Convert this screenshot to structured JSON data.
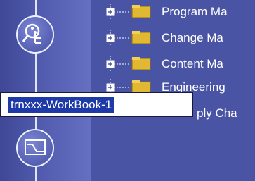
{
  "tree": {
    "items": [
      {
        "label": "Program Ma",
        "icon": "folder-icon"
      },
      {
        "label": "Change Ma",
        "icon": "folder-icon"
      },
      {
        "label": "Content Ma",
        "icon": "folder-icon"
      },
      {
        "label": "Engineering",
        "icon": "folder-icon"
      },
      {
        "label": "ply Cha",
        "icon": "folder-icon"
      }
    ]
  },
  "rail": {
    "buttons": [
      {
        "icon": "search-tree-icon"
      },
      {
        "icon": "compare-graph-icon"
      }
    ]
  },
  "rename": {
    "value": "trnxxx-WorkBook-1"
  },
  "colors": {
    "background": "#4a54a4",
    "selection": "#1e3aa8",
    "folder": "#e0b833"
  }
}
